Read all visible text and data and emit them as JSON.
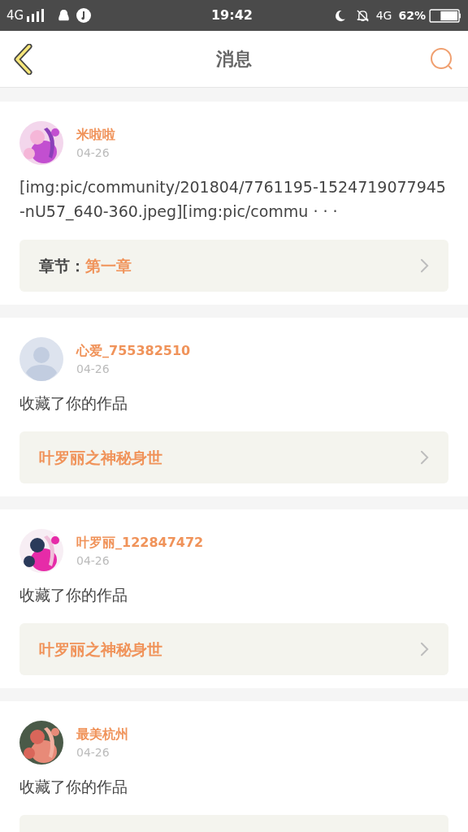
{
  "status_bar": {
    "network_left": "4G",
    "time": "19:42",
    "network_right": "4G",
    "battery": "62%"
  },
  "header": {
    "title": "消息"
  },
  "messages": [
    {
      "name": "米啦啦",
      "date": "04-26",
      "text": "[img:pic/community/201804/7761195-1524719077945-nU57_640-360.jpeg][img:pic/commu · · ·",
      "link": {
        "kind": "chapter",
        "label": "章节：",
        "title": "第一章"
      }
    },
    {
      "avatar": {
        "kind": "default"
      },
      "name": "心爱_755382510",
      "date": "04-26",
      "text": "收藏了你的作品",
      "link": {
        "kind": "work",
        "title": "叶罗丽之神秘身世"
      }
    },
    {
      "name": "叶罗丽_122847472",
      "date": "04-26",
      "text": "收藏了你的作品",
      "link": {
        "kind": "work",
        "title": "叶罗丽之神秘身世"
      }
    },
    {
      "name": "最美杭州",
      "date": "04-26",
      "text": "收藏了你的作品",
      "link": {
        "kind": "empty"
      }
    }
  ]
}
